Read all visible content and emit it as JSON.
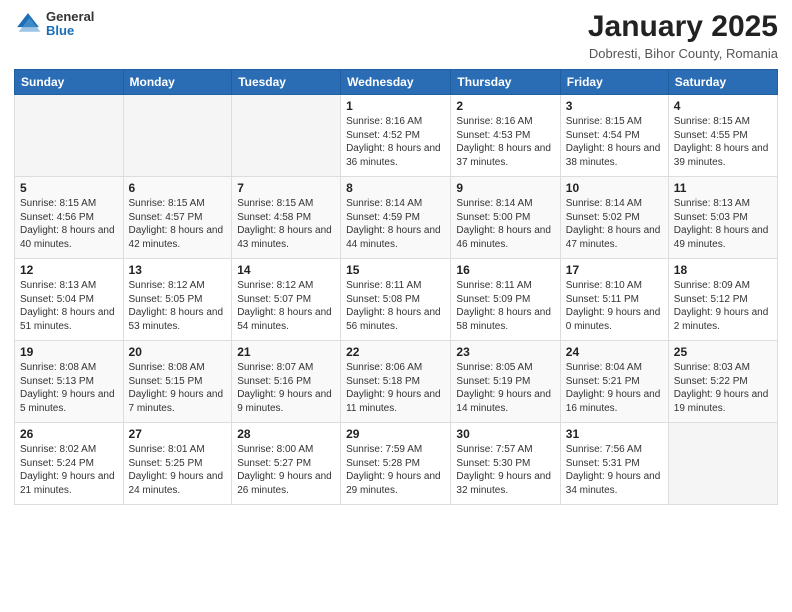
{
  "header": {
    "logo_general": "General",
    "logo_blue": "Blue",
    "month_title": "January 2025",
    "subtitle": "Dobresti, Bihor County, Romania"
  },
  "weekdays": [
    "Sunday",
    "Monday",
    "Tuesday",
    "Wednesday",
    "Thursday",
    "Friday",
    "Saturday"
  ],
  "weeks": [
    [
      {
        "day": "",
        "info": ""
      },
      {
        "day": "",
        "info": ""
      },
      {
        "day": "",
        "info": ""
      },
      {
        "day": "1",
        "info": "Sunrise: 8:16 AM\nSunset: 4:52 PM\nDaylight: 8 hours and 36 minutes."
      },
      {
        "day": "2",
        "info": "Sunrise: 8:16 AM\nSunset: 4:53 PM\nDaylight: 8 hours and 37 minutes."
      },
      {
        "day": "3",
        "info": "Sunrise: 8:15 AM\nSunset: 4:54 PM\nDaylight: 8 hours and 38 minutes."
      },
      {
        "day": "4",
        "info": "Sunrise: 8:15 AM\nSunset: 4:55 PM\nDaylight: 8 hours and 39 minutes."
      }
    ],
    [
      {
        "day": "5",
        "info": "Sunrise: 8:15 AM\nSunset: 4:56 PM\nDaylight: 8 hours and 40 minutes."
      },
      {
        "day": "6",
        "info": "Sunrise: 8:15 AM\nSunset: 4:57 PM\nDaylight: 8 hours and 42 minutes."
      },
      {
        "day": "7",
        "info": "Sunrise: 8:15 AM\nSunset: 4:58 PM\nDaylight: 8 hours and 43 minutes."
      },
      {
        "day": "8",
        "info": "Sunrise: 8:14 AM\nSunset: 4:59 PM\nDaylight: 8 hours and 44 minutes."
      },
      {
        "day": "9",
        "info": "Sunrise: 8:14 AM\nSunset: 5:00 PM\nDaylight: 8 hours and 46 minutes."
      },
      {
        "day": "10",
        "info": "Sunrise: 8:14 AM\nSunset: 5:02 PM\nDaylight: 8 hours and 47 minutes."
      },
      {
        "day": "11",
        "info": "Sunrise: 8:13 AM\nSunset: 5:03 PM\nDaylight: 8 hours and 49 minutes."
      }
    ],
    [
      {
        "day": "12",
        "info": "Sunrise: 8:13 AM\nSunset: 5:04 PM\nDaylight: 8 hours and 51 minutes."
      },
      {
        "day": "13",
        "info": "Sunrise: 8:12 AM\nSunset: 5:05 PM\nDaylight: 8 hours and 53 minutes."
      },
      {
        "day": "14",
        "info": "Sunrise: 8:12 AM\nSunset: 5:07 PM\nDaylight: 8 hours and 54 minutes."
      },
      {
        "day": "15",
        "info": "Sunrise: 8:11 AM\nSunset: 5:08 PM\nDaylight: 8 hours and 56 minutes."
      },
      {
        "day": "16",
        "info": "Sunrise: 8:11 AM\nSunset: 5:09 PM\nDaylight: 8 hours and 58 minutes."
      },
      {
        "day": "17",
        "info": "Sunrise: 8:10 AM\nSunset: 5:11 PM\nDaylight: 9 hours and 0 minutes."
      },
      {
        "day": "18",
        "info": "Sunrise: 8:09 AM\nSunset: 5:12 PM\nDaylight: 9 hours and 2 minutes."
      }
    ],
    [
      {
        "day": "19",
        "info": "Sunrise: 8:08 AM\nSunset: 5:13 PM\nDaylight: 9 hours and 5 minutes."
      },
      {
        "day": "20",
        "info": "Sunrise: 8:08 AM\nSunset: 5:15 PM\nDaylight: 9 hours and 7 minutes."
      },
      {
        "day": "21",
        "info": "Sunrise: 8:07 AM\nSunset: 5:16 PM\nDaylight: 9 hours and 9 minutes."
      },
      {
        "day": "22",
        "info": "Sunrise: 8:06 AM\nSunset: 5:18 PM\nDaylight: 9 hours and 11 minutes."
      },
      {
        "day": "23",
        "info": "Sunrise: 8:05 AM\nSunset: 5:19 PM\nDaylight: 9 hours and 14 minutes."
      },
      {
        "day": "24",
        "info": "Sunrise: 8:04 AM\nSunset: 5:21 PM\nDaylight: 9 hours and 16 minutes."
      },
      {
        "day": "25",
        "info": "Sunrise: 8:03 AM\nSunset: 5:22 PM\nDaylight: 9 hours and 19 minutes."
      }
    ],
    [
      {
        "day": "26",
        "info": "Sunrise: 8:02 AM\nSunset: 5:24 PM\nDaylight: 9 hours and 21 minutes."
      },
      {
        "day": "27",
        "info": "Sunrise: 8:01 AM\nSunset: 5:25 PM\nDaylight: 9 hours and 24 minutes."
      },
      {
        "day": "28",
        "info": "Sunrise: 8:00 AM\nSunset: 5:27 PM\nDaylight: 9 hours and 26 minutes."
      },
      {
        "day": "29",
        "info": "Sunrise: 7:59 AM\nSunset: 5:28 PM\nDaylight: 9 hours and 29 minutes."
      },
      {
        "day": "30",
        "info": "Sunrise: 7:57 AM\nSunset: 5:30 PM\nDaylight: 9 hours and 32 minutes."
      },
      {
        "day": "31",
        "info": "Sunrise: 7:56 AM\nSunset: 5:31 PM\nDaylight: 9 hours and 34 minutes."
      },
      {
        "day": "",
        "info": ""
      }
    ]
  ]
}
